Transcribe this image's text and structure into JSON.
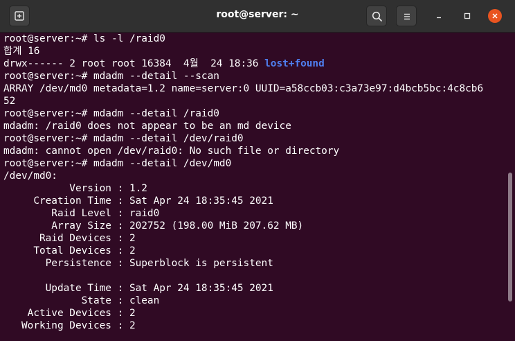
{
  "window": {
    "title": "root@server: ~",
    "new_tab_icon": "new-tab-icon",
    "search_icon": "search-icon",
    "menu_icon": "hamburger-menu-icon",
    "minimize_icon": "minimize-icon",
    "maximize_icon": "maximize-icon",
    "close_icon": "close-icon",
    "accent_color": "#e95420",
    "terminal_bg": "#300a24"
  },
  "terminal": {
    "lines": [
      "root@server:~# ls -l /raid0",
      "합계 16",
      "drwx------ 2 root root 16384  4월  24 18:36 ",
      "root@server:~# mdadm --detail --scan",
      "ARRAY /dev/md0 metadata=1.2 name=server:0 UUID=a58ccb03:c3a73e97:d4bcb5bc:4c8cb6",
      "52",
      "root@server:~# mdadm --detail /raid0",
      "mdadm: /raid0 does not appear to be an md device",
      "root@server:~# mdadm --detail /dev/raid0",
      "mdadm: cannot open /dev/raid0: No such file or directory",
      "root@server:~# mdadm --detail /dev/md0",
      "/dev/md0:",
      "           Version : 1.2",
      "     Creation Time : Sat Apr 24 18:35:45 2021",
      "        Raid Level : raid0",
      "        Array Size : 202752 (198.00 MiB 207.62 MB)",
      "      Raid Devices : 2",
      "     Total Devices : 2",
      "       Persistence : Superblock is persistent",
      "",
      "       Update Time : Sat Apr 24 18:35:45 2021",
      "             State : clean",
      "    Active Devices : 2",
      "   Working Devices : 2"
    ],
    "dir_entry": "lost+found",
    "dir_color": "#4f7ff0"
  }
}
